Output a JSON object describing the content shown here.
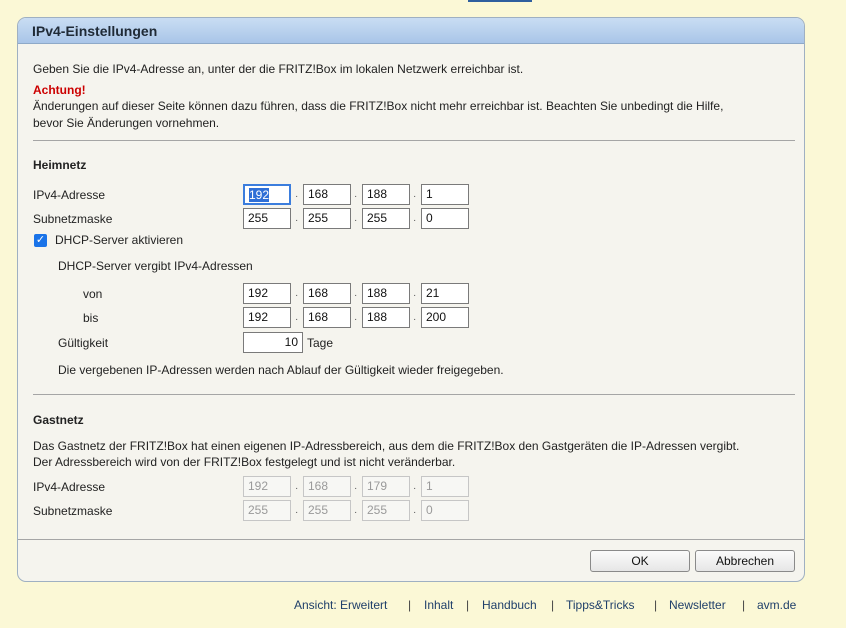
{
  "panel_title": "IPv4-Einstellungen",
  "intro": "Geben Sie die IPv4-Adresse an, unter der die FRITZ!Box im lokalen Netzwerk erreichbar ist.",
  "warning_title": "Achtung!",
  "warning_line1": "Änderungen auf dieser Seite können dazu führen, dass die FRITZ!Box nicht mehr erreichbar ist. Beachten Sie unbedingt die Hilfe,",
  "warning_line2": "bevor Sie Änderungen vornehmen.",
  "heimnetz": {
    "title": "Heimnetz",
    "ip_label": "IPv4-Adresse",
    "ip": [
      "192",
      "168",
      "188",
      "1"
    ],
    "mask_label": "Subnetzmaske",
    "mask": [
      "255",
      "255",
      "255",
      "0"
    ],
    "dhcp_checkbox_label": "DHCP-Server aktivieren",
    "dhcp_checked": true,
    "dhcp_range_label": "DHCP-Server vergibt IPv4-Adressen",
    "von_label": "von",
    "von": [
      "192",
      "168",
      "188",
      "21"
    ],
    "bis_label": "bis",
    "bis": [
      "192",
      "168",
      "188",
      "200"
    ],
    "validity_label": "Gültigkeit",
    "validity_value": "10",
    "validity_unit": "Tage",
    "validity_note": "Die vergebenen IP-Adressen werden nach Ablauf der Gültigkeit wieder freigegeben."
  },
  "gastnetz": {
    "title": "Gastnetz",
    "desc_line1": "Das Gastnetz der FRITZ!Box hat einen eigenen IP-Adressbereich, aus dem die FRITZ!Box den Gastgeräten die IP-Adressen vergibt.",
    "desc_line2": "Der Adressbereich wird von der FRITZ!Box festgelegt und ist nicht veränderbar.",
    "ip_label": "IPv4-Adresse",
    "ip": [
      "192",
      "168",
      "179",
      "1"
    ],
    "mask_label": "Subnetzmaske",
    "mask": [
      "255",
      "255",
      "255",
      "0"
    ]
  },
  "buttons": {
    "ok": "OK",
    "cancel": "Abbrechen"
  },
  "footer": {
    "view": "Ansicht: Erweitert",
    "content": "Inhalt",
    "manual": "Handbuch",
    "tips": "Tipps&Tricks",
    "newsletter": "Newsletter",
    "avm": "avm.de",
    "separator": "|"
  }
}
